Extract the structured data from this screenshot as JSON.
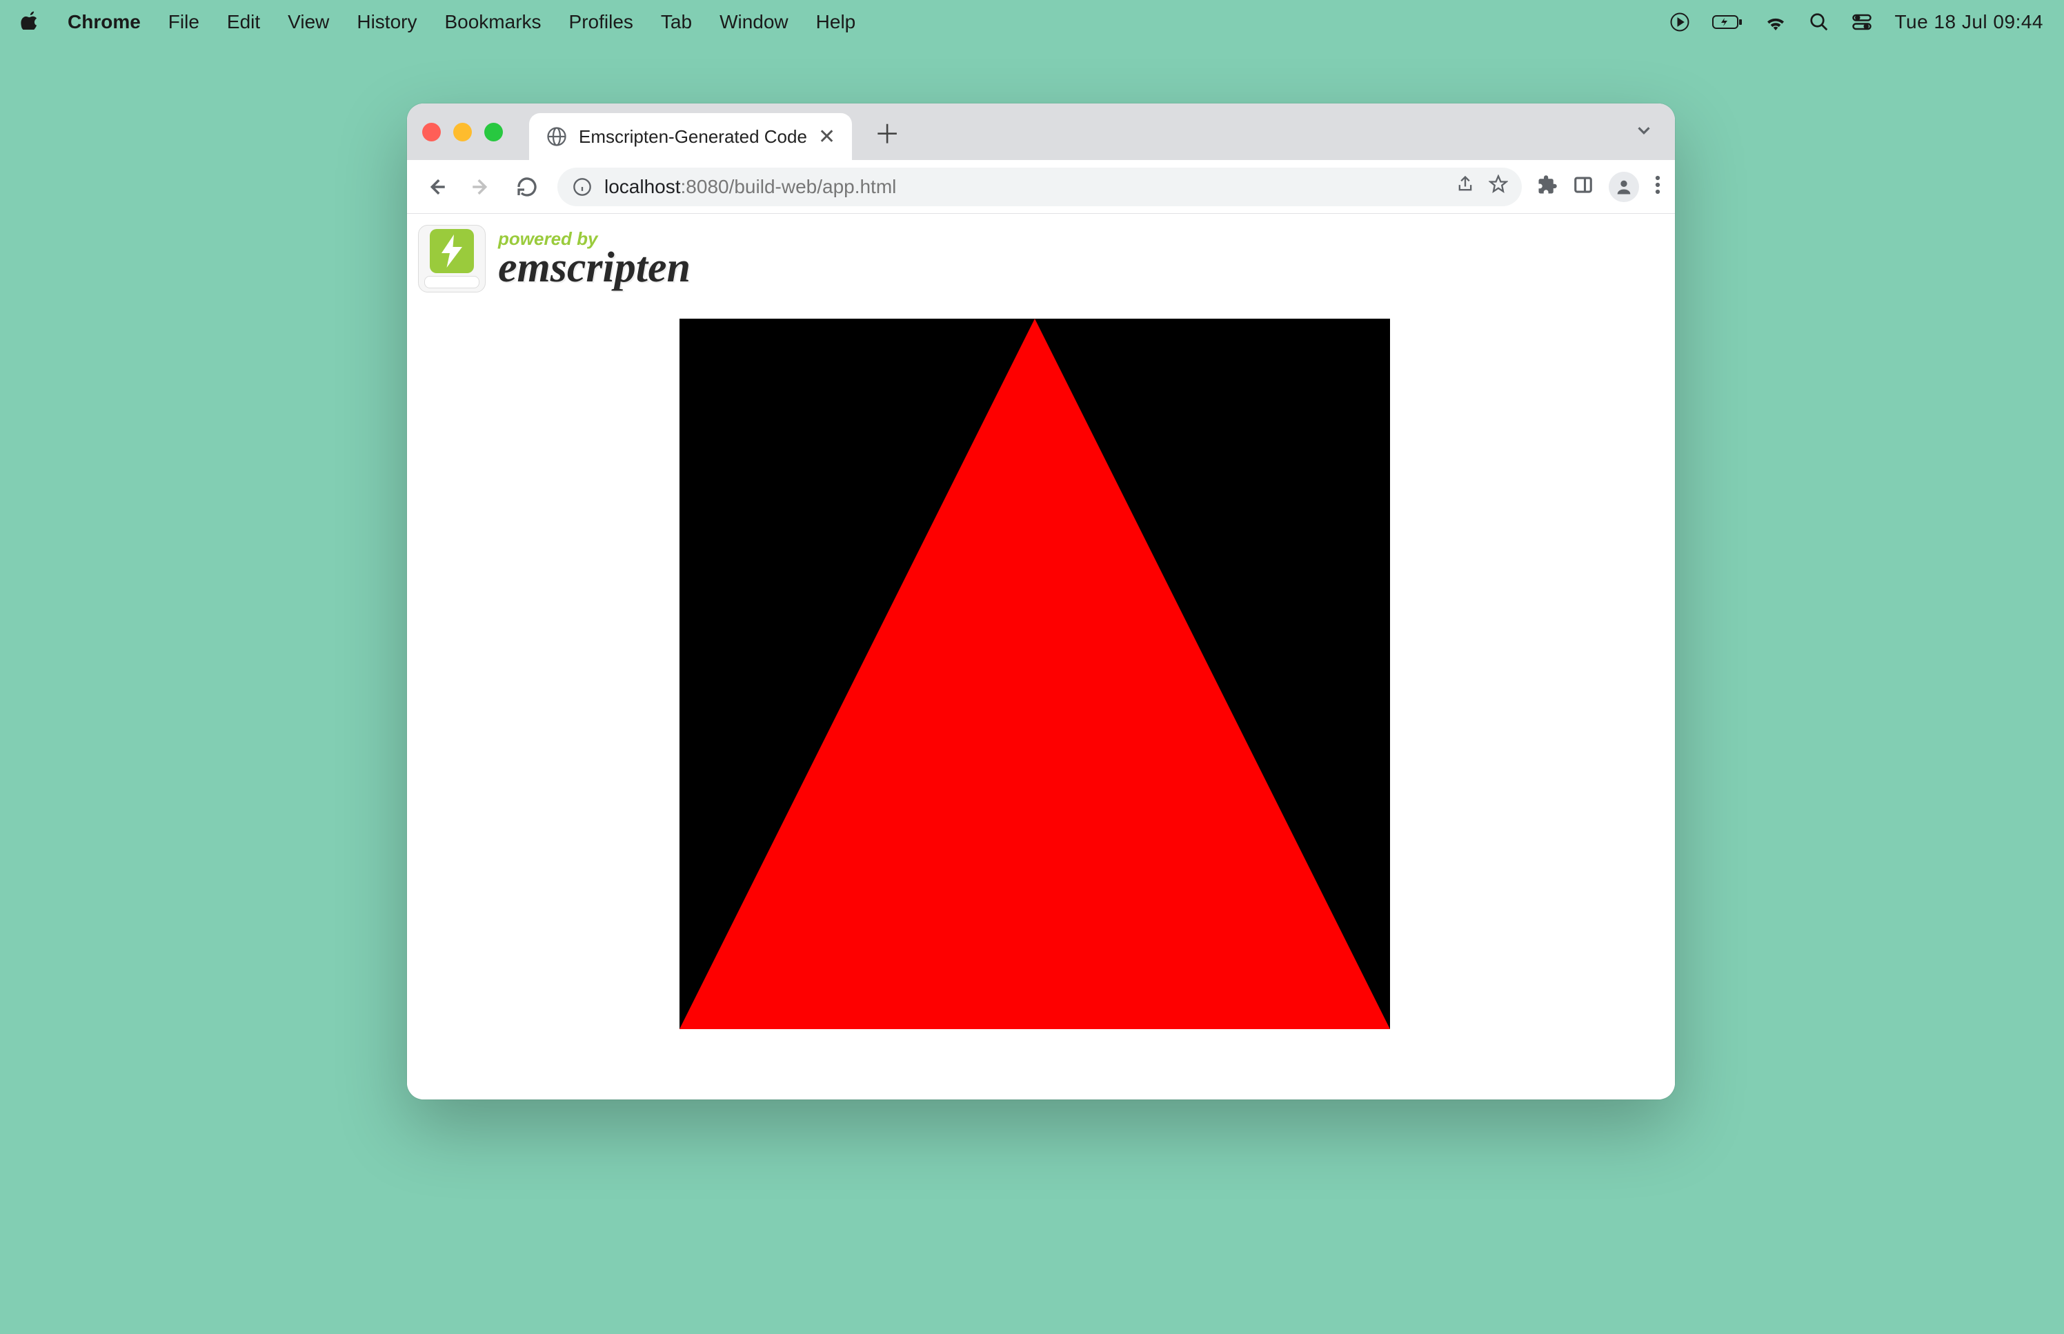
{
  "menubar": {
    "app_name": "Chrome",
    "items": [
      "File",
      "Edit",
      "View",
      "History",
      "Bookmarks",
      "Profiles",
      "Tab",
      "Window",
      "Help"
    ],
    "clock": "Tue 18 Jul  09:44"
  },
  "browser": {
    "tab": {
      "title": "Emscripten-Generated Code"
    },
    "url": {
      "host": "localhost",
      "rest": ":8080/build-web/app.html"
    }
  },
  "page": {
    "powered_by": "powered by",
    "emscripten": "emscripten"
  },
  "colors": {
    "desktop": "#82ceb3",
    "canvas_bg": "#000000",
    "triangle": "#fe0000",
    "em_green": "#9acb3c"
  }
}
